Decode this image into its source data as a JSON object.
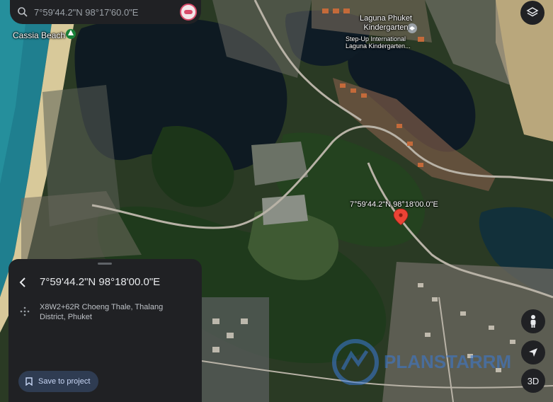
{
  "search": {
    "text": "7°59'44.2\"N 98°17'60.0\"E"
  },
  "map": {
    "labels": {
      "cassia_beach": "Cassia Beach",
      "laguna_kindergarten": "Laguna Phuket Kindergarten",
      "stepup_line1": "Step-Up International",
      "stepup_line2": "Laguna Kindergarten...",
      "pin_coords": "7°59'44.2\"N 98°18'00.0\"E"
    },
    "watermark_text": "PLANSTARRM",
    "colors": {
      "pin": "#ea4335",
      "water": "#0d1a26",
      "sea": "#1f7f8f",
      "forest": "#203a1f",
      "sand": "#c8b98c"
    }
  },
  "panel": {
    "coords": "7°59'44.2\"N 98°18'00.0\"E",
    "address": "X8W2+62R Choeng Thale, Thalang District, Phuket",
    "save_label": "Save to project"
  },
  "controls": {
    "layers_icon": "layers-icon",
    "pegman_icon": "pegman-icon",
    "location_icon": "navigation-arrow-icon",
    "three_d_label": "3D"
  }
}
